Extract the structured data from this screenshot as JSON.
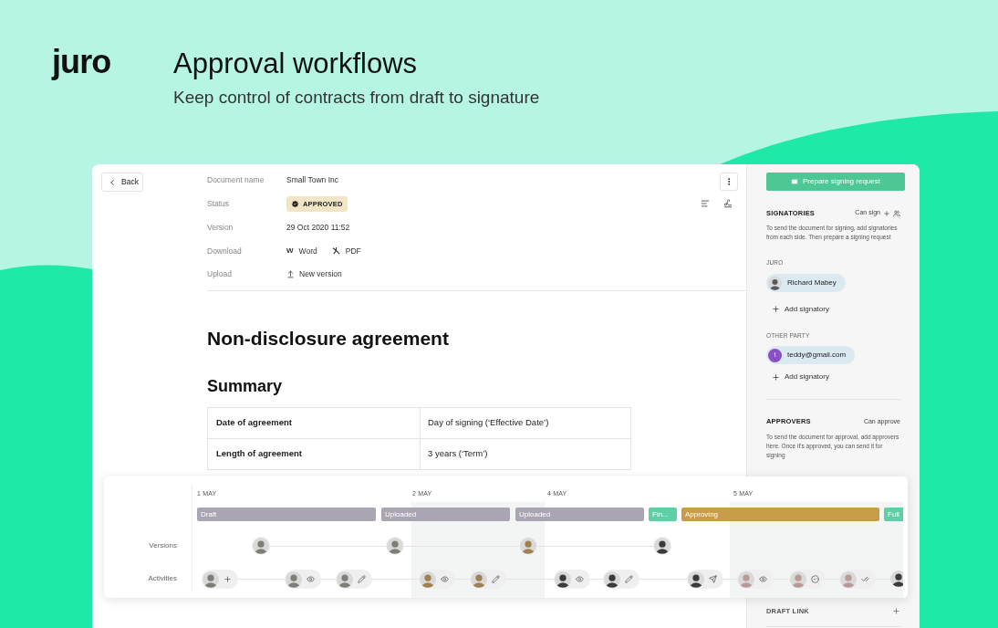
{
  "brand": {
    "logo": "juro",
    "title": "Approval workflows",
    "subtitle": "Keep control of contracts from draft to signature"
  },
  "back_button": "Back",
  "meta": [
    {
      "label": "Document name",
      "kind": "text",
      "value": "Small Town Inc"
    },
    {
      "label": "Status",
      "kind": "badge",
      "value": "APPROVED"
    },
    {
      "label": "Version",
      "kind": "text",
      "value": "29 Oct 2020 11:52"
    },
    {
      "label": "Download",
      "kind": "downloads",
      "items": [
        {
          "kind": "word",
          "glyph": "W",
          "label": "Word"
        },
        {
          "kind": "pdf",
          "label": "PDF"
        }
      ]
    },
    {
      "label": "Upload",
      "kind": "upload",
      "value": "New version"
    }
  ],
  "document": {
    "title": "Non-disclosure agreement",
    "section": "Summary",
    "table": {
      "rows": [
        [
          "Date of agreement",
          "Day of signing (‘Effective Date’)"
        ],
        [
          "Length of agreement",
          "3 years (‘Term’)"
        ]
      ]
    }
  },
  "sidebar": {
    "primary_button": "Prepare signing request",
    "signatories": {
      "heading": "SIGNATORIES",
      "action": "Can sign",
      "description": "To send the document for signing, add signatories from each side. Then prepare a signing request",
      "groups": [
        {
          "label": "JURO",
          "people": [
            {
              "name": "Richard Mabey",
              "kind": "photo"
            }
          ],
          "add": "Add signatory"
        },
        {
          "label": "OTHER PARTY",
          "people": [
            {
              "name": "teddy@gmail.com",
              "kind": "initial",
              "initial": "t",
              "color": "#8a4fc4"
            }
          ],
          "add": "Add signatory"
        }
      ]
    },
    "approvers": {
      "heading": "APPROVERS",
      "action": "Can approve",
      "description": "To send the document for approval, add approvers here. Once it's approved, you can send it for signing"
    },
    "draft_link": {
      "heading": "DRAFT LINK"
    }
  },
  "timeline": {
    "rows": [
      "Versions",
      "Activities"
    ],
    "dates": [
      "1 MAY",
      "2 MAY",
      "4 MAY",
      "5 MAY"
    ],
    "phases": [
      {
        "label": "Draft",
        "color": "#aaa5b3"
      },
      {
        "label": "Uploaded",
        "color": "#aaa5b3"
      },
      {
        "label": "Uploaded",
        "color": "#aaa5b3"
      },
      {
        "label": "Fin...",
        "color": "#5fcfa5"
      },
      {
        "label": "Approving",
        "color": "#c79d4a"
      },
      {
        "label": "Full",
        "color": "#5fcfa5"
      }
    ],
    "versions": [
      {
        "color": "#7a8078"
      },
      {
        "color": "#7a8078"
      },
      {
        "color": "#a08050"
      },
      {
        "color": "#3a3a3a"
      }
    ],
    "activities": [
      {
        "color": "#7a8078",
        "kind": "add"
      },
      {
        "color": "#7a8078",
        "kind": "view"
      },
      {
        "color": "#7a8078",
        "kind": "edit"
      },
      {
        "color": "#a08050",
        "kind": "view"
      },
      {
        "color": "#a08050",
        "kind": "edit"
      },
      {
        "color": "#3a3a3a",
        "kind": "view"
      },
      {
        "color": "#3a3a3a",
        "kind": "edit"
      },
      {
        "color": "#3a3a3a",
        "kind": "send"
      },
      {
        "color": "#b89a96",
        "kind": "view"
      },
      {
        "color": "#b89a96",
        "kind": "approve"
      },
      {
        "color": "#b89a96",
        "kind": "sign"
      },
      {
        "color": "#3a3a3a",
        "kind": "none"
      }
    ]
  }
}
